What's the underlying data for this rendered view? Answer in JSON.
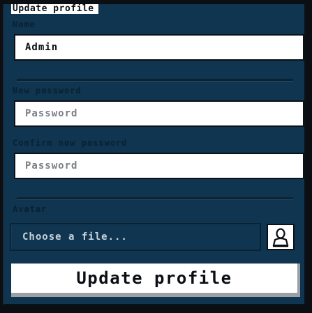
{
  "form": {
    "legend": "Update profile",
    "name_label": "Name",
    "name_value": "Admin",
    "new_password_label": "New password",
    "new_password_placeholder": "Password",
    "confirm_password_label": "Confirm new password",
    "confirm_password_placeholder": "Password",
    "avatar_label": "Avatar",
    "file_placeholder": "Choose a file...",
    "submit_label": "Update profile"
  },
  "icons": {
    "avatar_upload": "user-icon"
  },
  "colors": {
    "panel": "#0f3550",
    "frame": "#0b0f14",
    "field": "#ffffff"
  }
}
